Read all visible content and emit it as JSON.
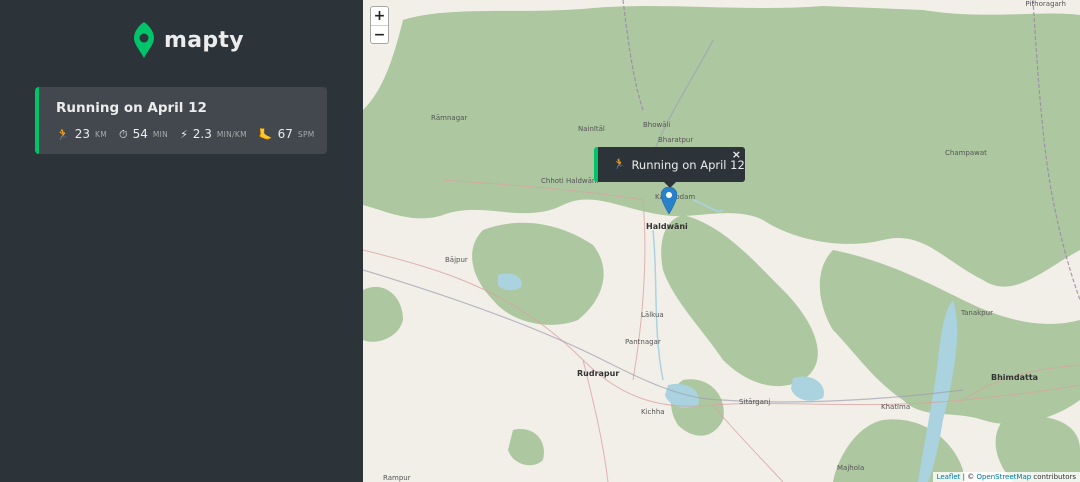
{
  "app": {
    "title": "mapty"
  },
  "workouts": [
    {
      "title": "Running on April 12",
      "type": "running",
      "accent": "#00c46a",
      "details": [
        {
          "icon": "🏃",
          "icon_name": "running-icon",
          "value": "23",
          "unit": "km"
        },
        {
          "icon": "⏱",
          "icon_name": "stopwatch-icon",
          "value": "54",
          "unit": "min"
        },
        {
          "icon": "⚡",
          "icon_name": "lightning-icon",
          "value": "2.3",
          "unit": "min/km"
        },
        {
          "icon": "🦶",
          "icon_name": "footprint-icon",
          "value": "67",
          "unit": "spm"
        }
      ]
    }
  ],
  "map": {
    "zoom_in": "+",
    "zoom_out": "−",
    "popup": {
      "icon": "🏃",
      "text": "Running on April 12",
      "close": "×"
    },
    "places": {
      "pithoragarh": "Pithoragarh",
      "ramnagar": "Rāmnagar",
      "nainital": "Nainītāl",
      "bhowali": "Bhowāli",
      "bharatpur": "Bharatpur",
      "champawat": "Champawat",
      "chhoti_haldwani": "Chhoti Haldwāni",
      "kathgodam": "Kathgodam",
      "haldwani": "Haldwāni",
      "bajpur": "Bājpur",
      "lalkua": "Lālkua",
      "pantnagar": "Pantnagar",
      "tanakpur": "Tanakpur",
      "rudrapur": "Rudrapur",
      "bhimdatta": "Bhimdatta",
      "kichha": "Kichha",
      "sitarganj": "Sitārganj",
      "khatima": "Khatīma",
      "majhola": "Majhola",
      "rampur": "Rampur"
    },
    "attribution": {
      "leaflet": "Leaflet",
      "separator": " | © ",
      "osm": "OpenStreetMap",
      "contributors": " contributors"
    }
  },
  "colors": {
    "sidebar_bg": "#2d3439",
    "card_bg": "#42484d",
    "running": "#00c46a",
    "forest": "#adc7a0",
    "land": "#f2efe9",
    "water": "#aad3df",
    "marker": "#2a81cb"
  }
}
